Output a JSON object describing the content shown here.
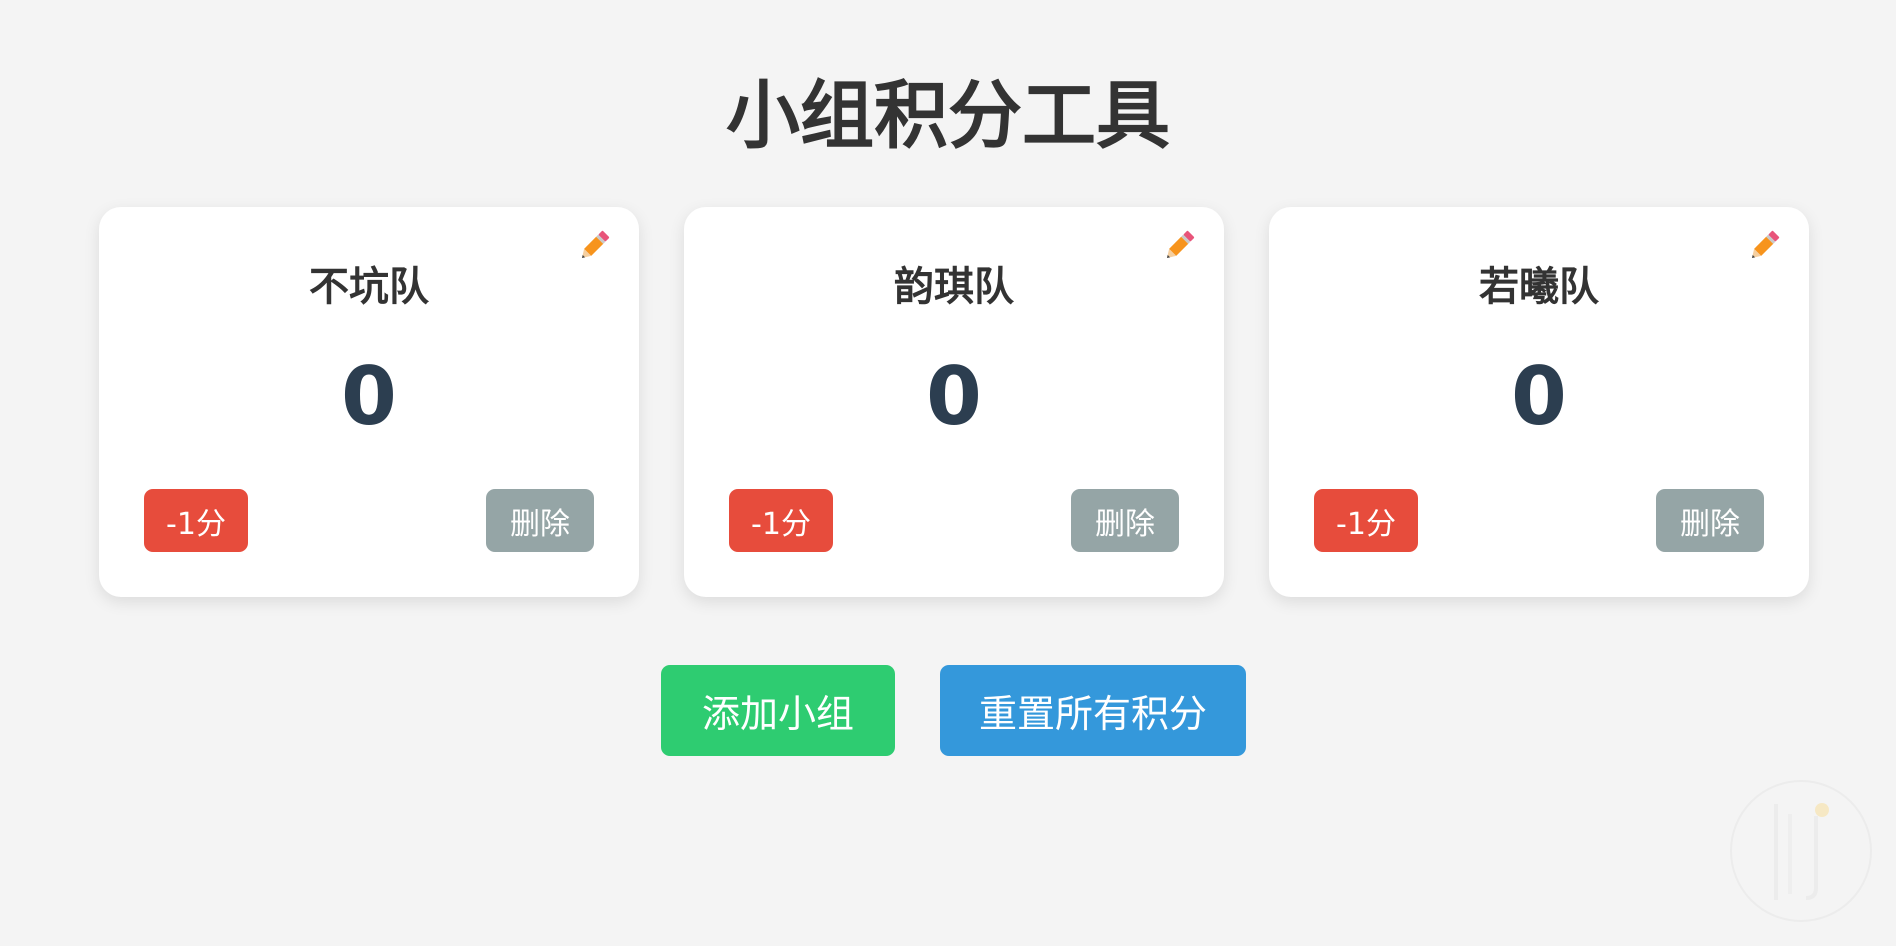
{
  "title": "小组积分工具",
  "teams": [
    {
      "name": "不坑队",
      "score": "0",
      "minus_label": "-1分",
      "delete_label": "删除"
    },
    {
      "name": "韵琪队",
      "score": "0",
      "minus_label": "-1分",
      "delete_label": "删除"
    },
    {
      "name": "若曦队",
      "score": "0",
      "minus_label": "-1分",
      "delete_label": "删除"
    }
  ],
  "actions": {
    "add_label": "添加小组",
    "reset_label": "重置所有积分"
  },
  "icons": {
    "edit": "pencil-icon"
  },
  "colors": {
    "background": "#f4f4f4",
    "minus_button": "#e74c3c",
    "delete_button": "#95a5a6",
    "add_button": "#2ecc71",
    "reset_button": "#3498db",
    "score_text": "#2c3e50"
  }
}
